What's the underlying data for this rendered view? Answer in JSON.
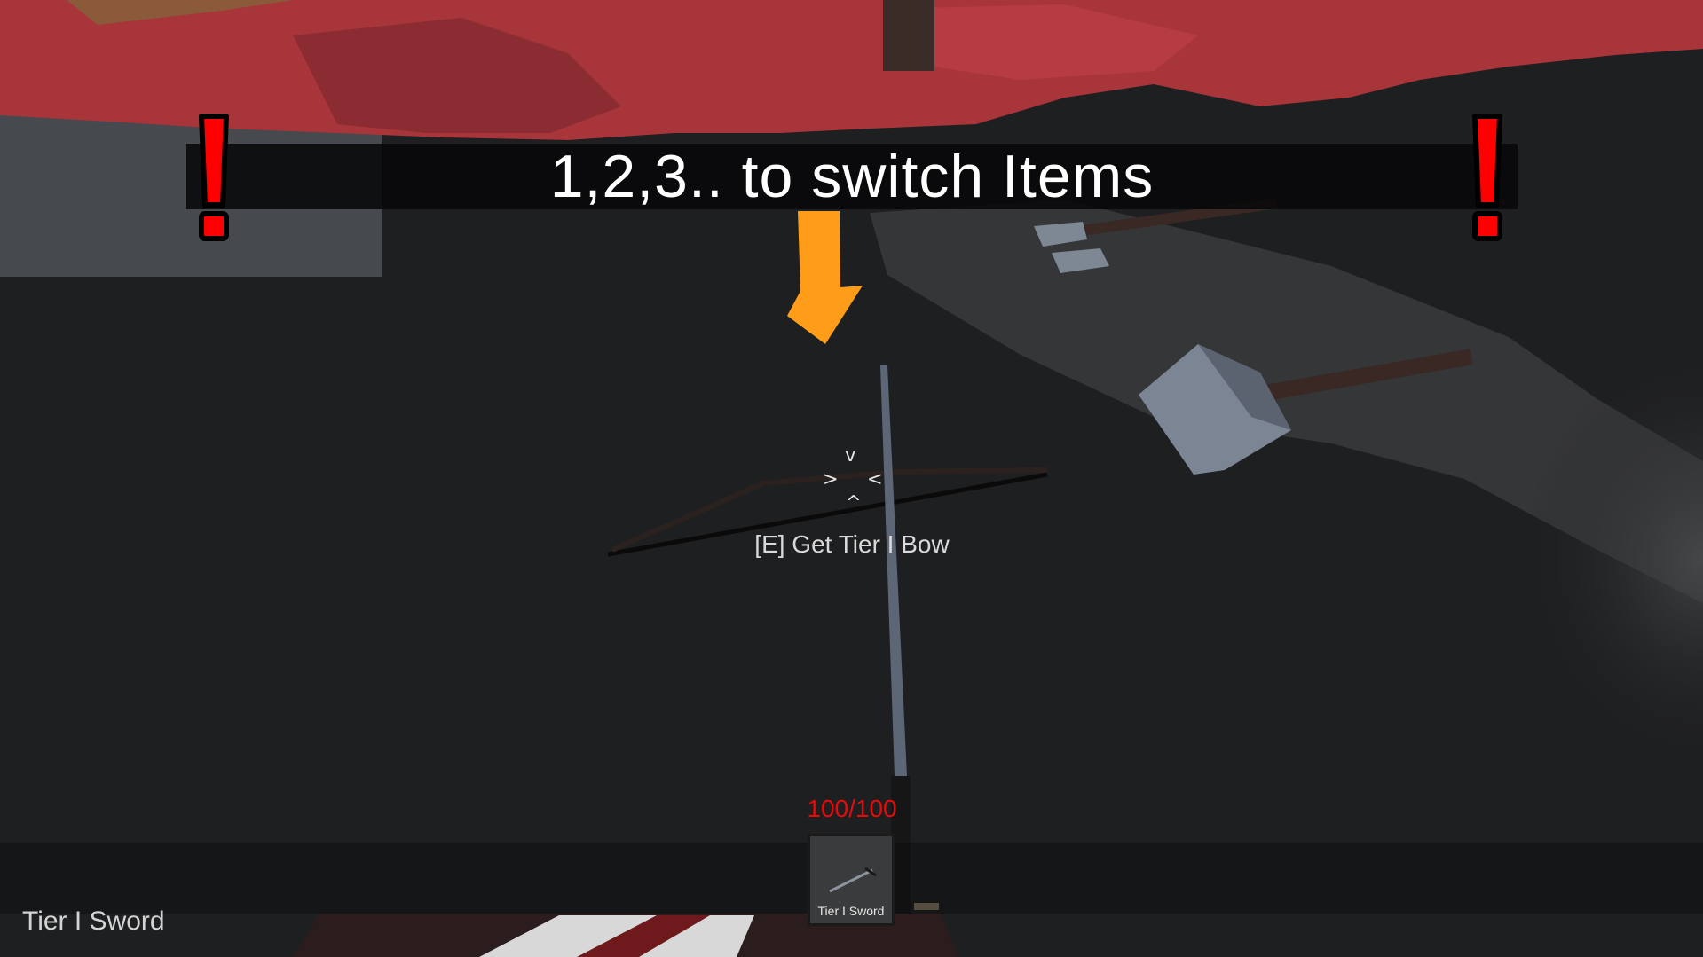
{
  "tutorial": {
    "banner_text": "1,2,3.. to switch Items"
  },
  "crosshair": {
    "top": "v",
    "left": ">",
    "right": "<",
    "bottom": "^"
  },
  "interaction": {
    "prompt": "[E] Get Tier I Bow"
  },
  "player": {
    "health_text": "100/100",
    "health_current": 100,
    "health_max": 100
  },
  "hotbar": {
    "slots": [
      {
        "label": "Tier I Sword",
        "selected": true
      }
    ]
  },
  "equipped": {
    "item_name": "Tier I Sword"
  },
  "colors": {
    "health": "#e30b0b",
    "warning": "#ff0000",
    "arrow": "#ff9d1a",
    "banner_bg": "#080809",
    "ground": "#1e1f21",
    "red_foliage": "#b2353a"
  }
}
